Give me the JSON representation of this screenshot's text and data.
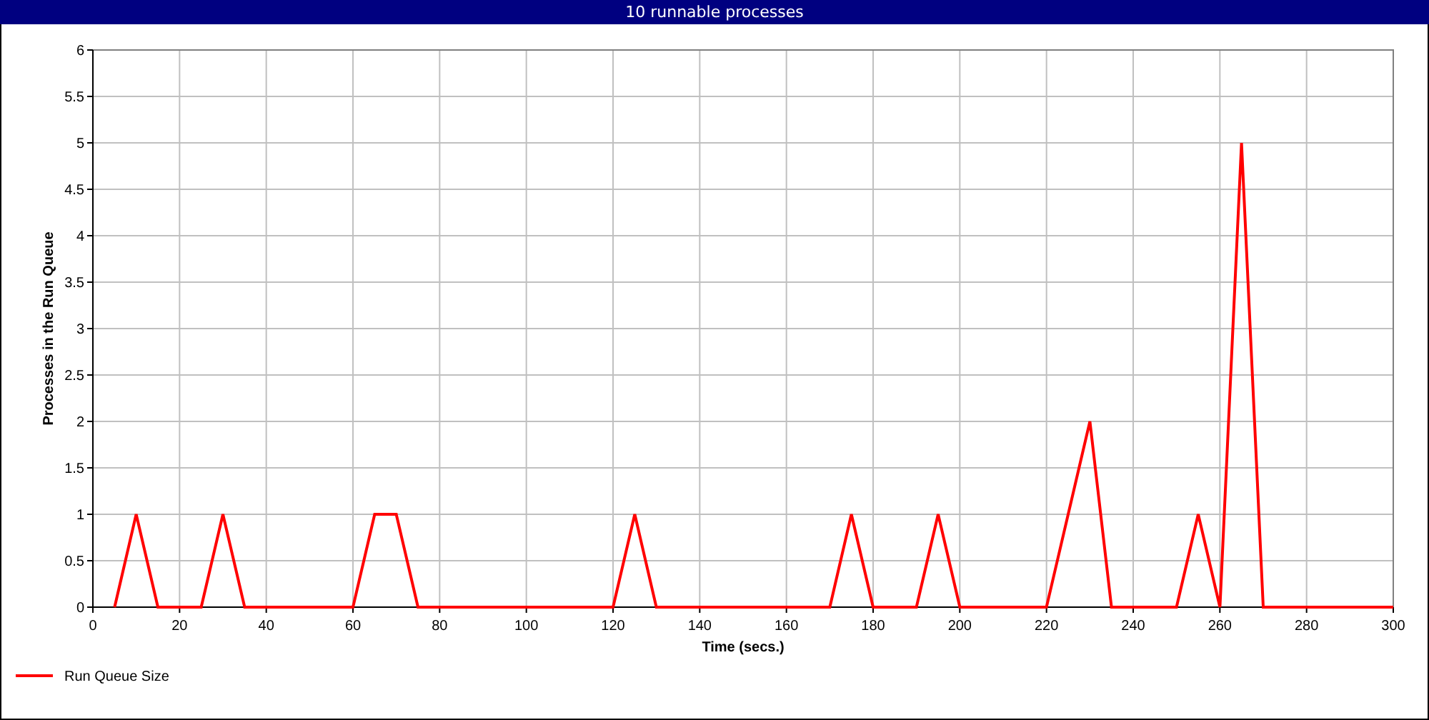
{
  "window": {
    "title": "10 runnable processes"
  },
  "chart": {
    "chart_data": {
      "type": "line",
      "xlabel": "Time (secs.)",
      "ylabel": "Processes in the Run Queue",
      "x": [
        5,
        10,
        15,
        20,
        25,
        30,
        35,
        40,
        45,
        50,
        55,
        60,
        65,
        70,
        75,
        80,
        85,
        90,
        95,
        100,
        105,
        110,
        115,
        120,
        125,
        130,
        135,
        140,
        145,
        150,
        155,
        160,
        165,
        170,
        175,
        180,
        185,
        190,
        195,
        200,
        205,
        210,
        215,
        220,
        225,
        230,
        235,
        240,
        245,
        250,
        255,
        260,
        265,
        270,
        275,
        280,
        285,
        290,
        295,
        300
      ],
      "series": [
        {
          "name": "Run Queue Size",
          "color": "#ff0000",
          "values": [
            0,
            1,
            0,
            0,
            0,
            1,
            0,
            0,
            0,
            0,
            0,
            0,
            1,
            1,
            0,
            0,
            0,
            0,
            0,
            0,
            0,
            0,
            0,
            0,
            1,
            0,
            0,
            0,
            0,
            0,
            0,
            0,
            0,
            0,
            1,
            0,
            0,
            0,
            1,
            0,
            0,
            0,
            0,
            0,
            1,
            2,
            0,
            0,
            0,
            0,
            1,
            0,
            5,
            0,
            0,
            0,
            0,
            0,
            0,
            0
          ]
        }
      ],
      "grid": true,
      "xlim": [
        0,
        300
      ],
      "ylim": [
        0,
        6
      ],
      "xticks": [
        0,
        20,
        40,
        60,
        80,
        100,
        120,
        140,
        160,
        180,
        200,
        220,
        240,
        260,
        280,
        300
      ],
      "yticks": [
        0,
        0.5,
        1,
        1.5,
        2,
        2.5,
        3,
        3.5,
        4,
        4.5,
        5,
        5.5,
        6
      ]
    }
  }
}
